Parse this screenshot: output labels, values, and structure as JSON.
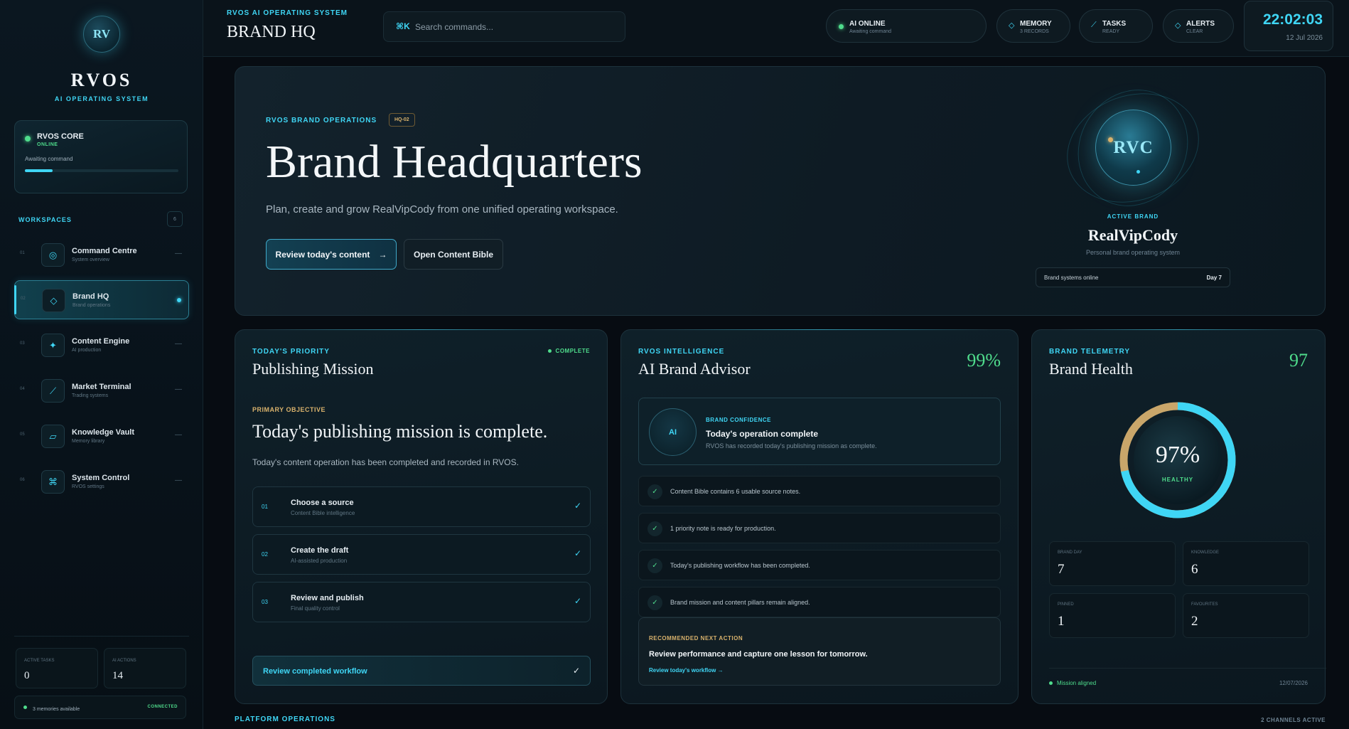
{
  "sidebar": {
    "logo_initials": "RV",
    "brand_name": "RVOS",
    "brand_sub": "AI OPERATING SYSTEM",
    "core": {
      "title": "RVOS CORE",
      "status": "ONLINE",
      "message": "Awaiting command",
      "progress_percent": 18
    },
    "workspaces_label": "WORKSPACES",
    "workspaces_count": "6",
    "items": [
      {
        "num": "01",
        "icon": "target-icon",
        "glyph": "◎",
        "title": "Command Centre",
        "sub": "System overview",
        "active": false
      },
      {
        "num": "02",
        "icon": "diamond-icon",
        "glyph": "◇",
        "title": "Brand HQ",
        "sub": "Brand operations",
        "active": true
      },
      {
        "num": "03",
        "icon": "sparkle-icon",
        "glyph": "✦",
        "title": "Content Engine",
        "sub": "AI production",
        "active": false
      },
      {
        "num": "04",
        "icon": "trend-icon",
        "glyph": "⟋",
        "title": "Market Terminal",
        "sub": "Trading systems",
        "active": false
      },
      {
        "num": "05",
        "icon": "folder-icon",
        "glyph": "▱",
        "title": "Knowledge Vault",
        "sub": "Memory library",
        "active": false
      },
      {
        "num": "06",
        "icon": "command-icon",
        "glyph": "⌘",
        "title": "System Control",
        "sub": "RVOS settings",
        "active": false
      }
    ],
    "stats": [
      {
        "label": "ACTIVE TASKS",
        "value": "0"
      },
      {
        "label": "AI ACTIONS",
        "value": "14"
      }
    ],
    "memory": {
      "text": "3 memories available",
      "status": "CONNECTED"
    }
  },
  "topbar": {
    "kicker": "RVOS AI OPERATING SYSTEM",
    "title": "BRAND HQ",
    "search": {
      "icon": "command-icon",
      "placeholder": "Search commands..."
    },
    "pills": [
      {
        "name": "ai-online",
        "title": "AI ONLINE",
        "sub": "Awaiting command"
      },
      {
        "name": "memory",
        "title": "MEMORY",
        "sub": "3 RECORDS"
      },
      {
        "name": "tasks",
        "title": "TASKS",
        "sub": "READY"
      },
      {
        "name": "alerts",
        "title": "ALERTS",
        "sub": "CLEAR"
      }
    ],
    "clock": {
      "time": "22:02:03",
      "date": "12 Jul 2026"
    }
  },
  "hero": {
    "kicker": "RVOS BRAND OPERATIONS",
    "tag": "HQ-02",
    "title": "Brand Headquarters",
    "desc": "Plan, create and grow RealVipCody from one unified operating workspace.",
    "primary_btn": "Review today's content",
    "primary_arrow": "→",
    "secondary_btn": "Open Content Bible",
    "orb_initials": "RVC",
    "active_brand_label": "ACTIVE BRAND",
    "active_brand_name": "RealVipCody",
    "active_brand_sub": "Personal brand operating system",
    "status_left": "Brand systems online",
    "status_right": "Day 7"
  },
  "priority": {
    "kicker": "TODAY'S PRIORITY",
    "title": "Publishing Mission",
    "status": "COMPLETE",
    "objective_label": "PRIMARY OBJECTIVE",
    "objective_title": "Today's publishing mission is complete.",
    "objective_desc": "Today's content operation has been completed and recorded in RVOS.",
    "steps": [
      {
        "num": "01",
        "title": "Choose a source",
        "sub": "Content Bible intelligence"
      },
      {
        "num": "02",
        "title": "Create the draft",
        "sub": "AI-assisted production"
      },
      {
        "num": "03",
        "title": "Review and publish",
        "sub": "Final quality control"
      }
    ],
    "check": "✓",
    "review_btn": "Review completed workflow"
  },
  "advisor": {
    "kicker": "RVOS INTELLIGENCE",
    "title": "AI Brand Advisor",
    "score": "99%",
    "orb_label": "AI",
    "confidence_label": "BRAND CONFIDENCE",
    "confidence_title": "Today's operation complete",
    "confidence_sub": "RVOS has recorded today's publishing mission as complete.",
    "insights": [
      "Content Bible contains 6 usable source notes.",
      "1 priority note is ready for production.",
      "Today's publishing workflow has been completed.",
      "Brand mission and content pillars remain aligned."
    ],
    "rec_label": "RECOMMENDED NEXT ACTION",
    "rec_title": "Review performance and capture one lesson for tomorrow.",
    "rec_link": "Review today's workflow →"
  },
  "health": {
    "kicker": "BRAND TELEMETRY",
    "title": "Brand Health",
    "score": "97",
    "gauge_value_percent": 97,
    "gauge_text": "97%",
    "gauge_label": "HEALTHY",
    "metrics": [
      {
        "label": "BRAND DAY",
        "value": "7"
      },
      {
        "label": "KNOWLEDGE",
        "value": "6"
      },
      {
        "label": "PINNED",
        "value": "1"
      },
      {
        "label": "FAVOURITES",
        "value": "2"
      }
    ],
    "footer_left": "Mission aligned",
    "footer_right": "12/07/2026"
  },
  "platform": {
    "label": "PLATFORM OPERATIONS",
    "count": "2 CHANNELS ACTIVE"
  },
  "colors": {
    "accent": "#3fd6f5",
    "success": "#4fdc8c",
    "gold": "#d9b26c",
    "background": "#070c12"
  }
}
